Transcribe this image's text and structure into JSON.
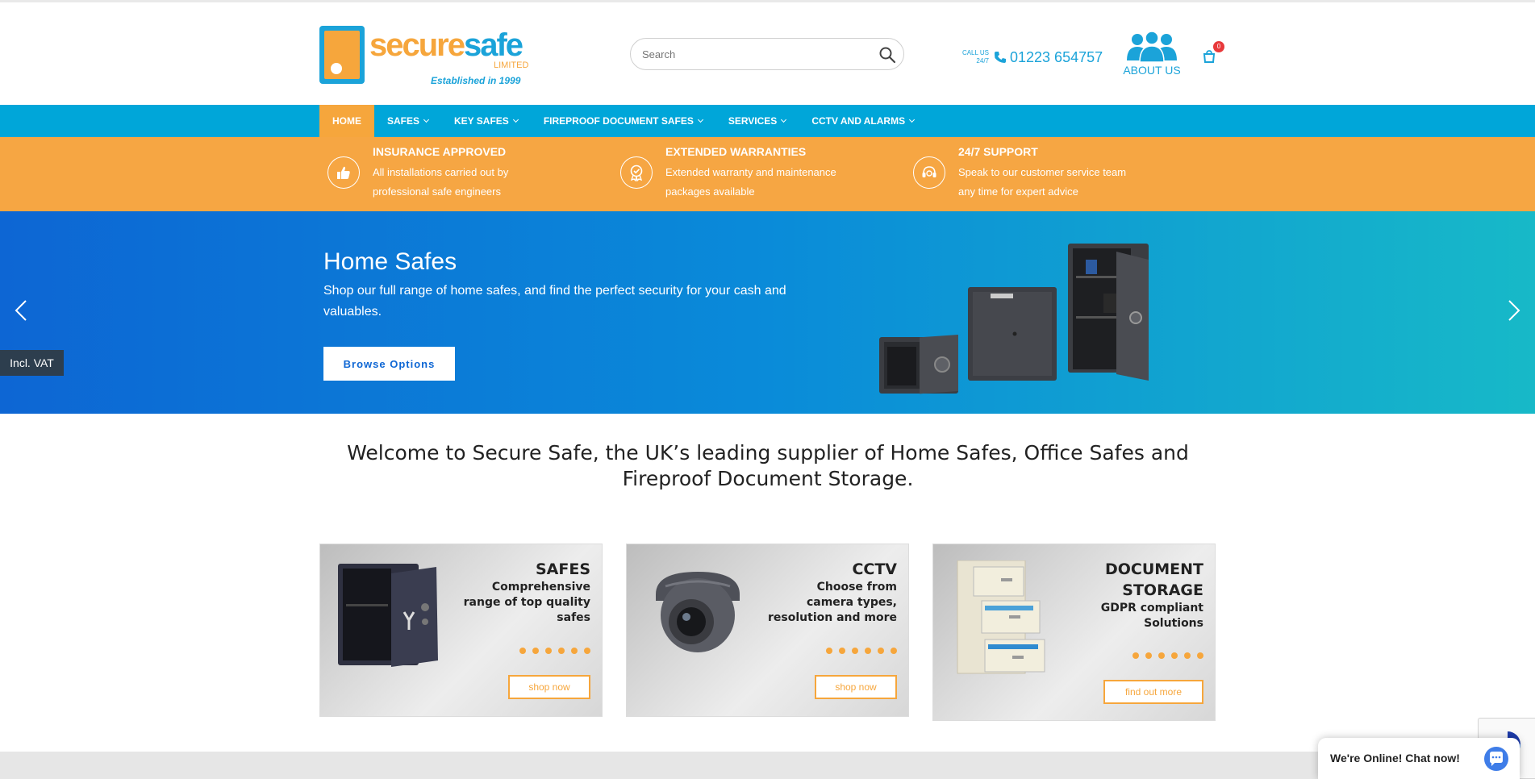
{
  "header": {
    "logo": {
      "word_a": "secure",
      "word_b": "safe",
      "limited": "LIMITED",
      "established": "Established in 1999"
    },
    "search": {
      "placeholder": "Search"
    },
    "call": {
      "small_line1": "CALL US",
      "small_line2": "24/7",
      "number": "01223 654757"
    },
    "about_label": "ABOUT US",
    "cart_count": "0"
  },
  "nav": {
    "items": [
      {
        "label": "HOME",
        "active": true
      },
      {
        "label": "SAFES"
      },
      {
        "label": "KEY SAFES"
      },
      {
        "label": "FIREPROOF DOCUMENT SAFES"
      },
      {
        "label": "SERVICES"
      },
      {
        "label": "CCTV AND ALARMS"
      }
    ]
  },
  "features": [
    {
      "icon": "thumbs-up-icon",
      "title": "INSURANCE APPROVED",
      "text": "All installations carried out by professional safe engineers"
    },
    {
      "icon": "award-badge-icon",
      "title": "EXTENDED WARRANTIES",
      "text": "Extended warranty and maintenance packages available"
    },
    {
      "icon": "headset-support-icon",
      "title": "24/7 SUPPORT",
      "text": "Speak to our customer service team any time for expert advice"
    }
  ],
  "hero": {
    "title": "Home Safes",
    "text": "Shop our full range of home safes, and find the perfect security for your cash and valuables.",
    "button": "Browse Options",
    "vat": "Incl. VAT"
  },
  "welcome": "Welcome to Secure Safe, the UK’s leading supplier of Home Safes, Office Safes and Fireproof Document Storage.",
  "cards": [
    {
      "title": "SAFES",
      "sub": "Comprehensive range of top quality safes",
      "button": "shop now"
    },
    {
      "title": "CCTV",
      "sub": "Choose from camera types, resolution and more",
      "button": "shop now"
    },
    {
      "title": "DOCUMENT STORAGE",
      "sub": "GDPR compliant Solutions",
      "button": "find out more"
    }
  ],
  "chat": {
    "text": "We're Online! Chat now!"
  },
  "colors": {
    "brand_blue": "#00a6d9",
    "brand_orange": "#f6a643",
    "badge_red": "#e8393b"
  }
}
